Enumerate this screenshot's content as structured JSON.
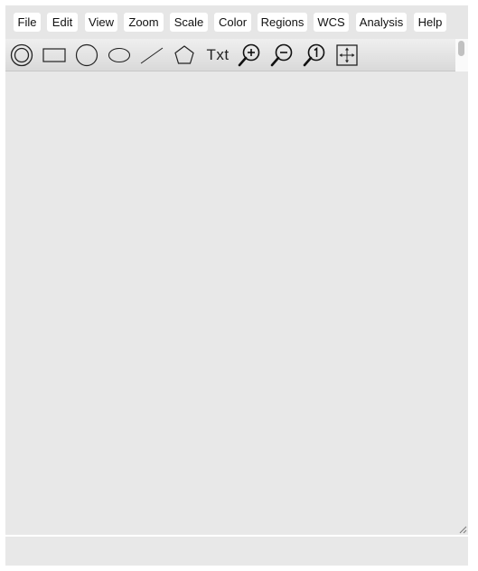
{
  "menu": {
    "items": [
      "File",
      "Edit",
      "View",
      "Zoom",
      "Scale",
      "Color",
      "Regions",
      "WCS",
      "Analysis",
      "Help"
    ]
  },
  "toolbar": {
    "tools": [
      {
        "name": "annulus-region-tool",
        "icon": "annulus-icon"
      },
      {
        "name": "box-region-tool",
        "icon": "rectangle-icon"
      },
      {
        "name": "circle-region-tool",
        "icon": "circle-icon"
      },
      {
        "name": "ellipse-region-tool",
        "icon": "ellipse-icon"
      },
      {
        "name": "line-region-tool",
        "icon": "line-icon"
      },
      {
        "name": "polygon-region-tool",
        "icon": "pentagon-icon"
      },
      {
        "name": "text-region-tool",
        "icon": "text-icon",
        "label": "Txt"
      },
      {
        "name": "zoom-in-tool",
        "icon": "zoom-in-icon"
      },
      {
        "name": "zoom-out-tool",
        "icon": "zoom-out-icon"
      },
      {
        "name": "zoom-reset-tool",
        "icon": "zoom-1-icon"
      },
      {
        "name": "pan-tool",
        "icon": "move-arrows-icon"
      }
    ]
  },
  "status": {
    "text": ""
  },
  "colors": {
    "background": "#e8e8e8",
    "toolbar": "#e0e0e0",
    "menu_button": "#ffffff"
  }
}
